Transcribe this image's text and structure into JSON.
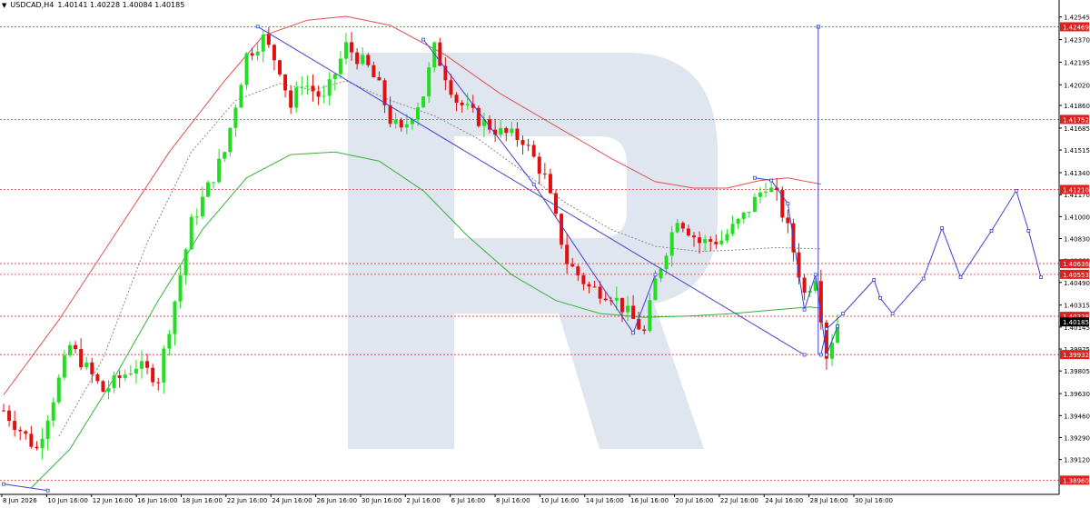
{
  "header": {
    "symbol": "USDCAD,H4",
    "ohlc": "1.40141 1.40228 1.40084 1.40185"
  },
  "chart_data": {
    "type": "candlestick",
    "symbol": "USDCAD",
    "timeframe": "H4",
    "ylim": [
      1.3885,
      1.4262
    ],
    "price_ticks": [
      "1.42545",
      "1.42370",
      "1.42195",
      "1.42020",
      "1.41860",
      "1.41685",
      "1.41515",
      "1.41340",
      "1.41170",
      "1.41000",
      "1.40830",
      "1.40660",
      "1.40490",
      "1.40315",
      "1.40145",
      "1.39975",
      "1.39805",
      "1.39630",
      "1.39460",
      "1.39290",
      "1.39120"
    ],
    "time_ticks": [
      "8 Jun 2026",
      "10 Jun 16:00",
      "12 Jun 16:00",
      "16 Jun 16:00",
      "18 Jun 16:00",
      "22 Jun 16:00",
      "24 Jun 16:00",
      "26 Jun 16:00",
      "30 Jun 16:00",
      "2 Jul 16:00",
      "6 Jul 16:00",
      "8 Jul 16:00",
      "10 Jul 16:00",
      "14 Jul 16:00",
      "16 Jul 16:00",
      "20 Jul 16:00",
      "22 Jul 16:00",
      "24 Jul 16:00",
      "28 Jul 16:00",
      "30 Jul 16:00"
    ],
    "levels": [
      {
        "label": "1.42469",
        "value": 1.42469
      },
      {
        "label": "1.41752",
        "value": 1.41752
      },
      {
        "label": "1.41210",
        "value": 1.4121
      },
      {
        "label": "1.40636",
        "value": 1.40636
      },
      {
        "label": "1.40553",
        "value": 1.40553
      },
      {
        "label": "1.40228",
        "value": 1.40228
      },
      {
        "label": "1.39932",
        "value": 1.39932
      },
      {
        "label": "1.38960",
        "value": 1.3896
      }
    ],
    "current_price": {
      "label": "1.40185",
      "value": 1.40185
    },
    "candle_count": 152,
    "price_path": [
      [
        0,
        1.395
      ],
      [
        6,
        1.392
      ],
      [
        12,
        1.4
      ],
      [
        18,
        1.3965
      ],
      [
        24,
        1.3985
      ],
      [
        28,
        1.3975
      ],
      [
        34,
        1.4095
      ],
      [
        40,
        1.415
      ],
      [
        44,
        1.4225
      ],
      [
        47,
        1.4238
      ],
      [
        50,
        1.4215
      ],
      [
        52,
        1.4185
      ],
      [
        54,
        1.4205
      ],
      [
        58,
        1.419
      ],
      [
        62,
        1.4232
      ],
      [
        66,
        1.4215
      ],
      [
        68,
        1.42
      ],
      [
        70,
        1.4175
      ],
      [
        72,
        1.4165
      ],
      [
        76,
        1.4195
      ],
      [
        78,
        1.423
      ],
      [
        82,
        1.419
      ],
      [
        86,
        1.4175
      ],
      [
        90,
        1.4165
      ],
      [
        94,
        1.416
      ],
      [
        98,
        1.413
      ],
      [
        102,
        1.4065
      ],
      [
        106,
        1.4045
      ],
      [
        110,
        1.404
      ],
      [
        114,
        1.402
      ],
      [
        116,
        1.401
      ],
      [
        118,
        1.405
      ],
      [
        122,
        1.41
      ],
      [
        126,
        1.408
      ],
      [
        130,
        1.4082
      ],
      [
        134,
        1.41
      ],
      [
        138,
        1.4125
      ],
      [
        140,
        1.4115
      ],
      [
        142,
        1.409
      ],
      [
        145,
        1.404
      ],
      [
        147,
        1.4055
      ],
      [
        149,
        1.3993
      ],
      [
        151,
        1.4018
      ]
    ],
    "moving_averages": [
      {
        "name": "",
        "color": "#e05050",
        "points": [
          [
            0,
            1.3962
          ],
          [
            10,
            1.402
          ],
          [
            20,
            1.4085
          ],
          [
            30,
            1.415
          ],
          [
            40,
            1.4205
          ],
          [
            47,
            1.424
          ],
          [
            55,
            1.4252
          ],
          [
            62,
            1.4255
          ],
          [
            70,
            1.4248
          ],
          [
            80,
            1.4225
          ],
          [
            90,
            1.4195
          ],
          [
            100,
            1.417
          ],
          [
            110,
            1.4145
          ],
          [
            118,
            1.4127
          ],
          [
            125,
            1.4122
          ],
          [
            131,
            1.4122
          ],
          [
            137,
            1.4128
          ],
          [
            142,
            1.413
          ],
          [
            148,
            1.4125
          ]
        ]
      },
      {
        "name": "",
        "color": "#39b039",
        "points": [
          [
            5,
            1.389
          ],
          [
            12,
            1.392
          ],
          [
            20,
            1.3975
          ],
          [
            28,
            1.4035
          ],
          [
            36,
            1.409
          ],
          [
            44,
            1.413
          ],
          [
            52,
            1.4148
          ],
          [
            60,
            1.415
          ],
          [
            68,
            1.4143
          ],
          [
            76,
            1.412
          ],
          [
            84,
            1.4085
          ],
          [
            92,
            1.4055
          ],
          [
            100,
            1.4035
          ],
          [
            108,
            1.4025
          ],
          [
            116,
            1.4022
          ],
          [
            124,
            1.4023
          ],
          [
            132,
            1.4025
          ],
          [
            140,
            1.4028
          ],
          [
            146,
            1.403
          ],
          [
            148,
            1.4029
          ]
        ]
      },
      {
        "name": "",
        "color": "#888888",
        "dashed": true,
        "points": [
          [
            10,
            1.393
          ],
          [
            18,
            1.399
          ],
          [
            26,
            1.408
          ],
          [
            34,
            1.415
          ],
          [
            42,
            1.419
          ],
          [
            50,
            1.4203
          ],
          [
            56,
            1.4198
          ],
          [
            62,
            1.4205
          ],
          [
            70,
            1.419
          ],
          [
            78,
            1.4178
          ],
          [
            86,
            1.416
          ],
          [
            94,
            1.4135
          ],
          [
            102,
            1.411
          ],
          [
            110,
            1.409
          ],
          [
            118,
            1.4077
          ],
          [
            126,
            1.4073
          ],
          [
            132,
            1.4074
          ],
          [
            140,
            1.4076
          ],
          [
            148,
            1.4075
          ]
        ]
      }
    ],
    "trend_lines": [
      {
        "color": "#4040d0",
        "points": [
          [
            46,
            1.4247
          ],
          [
            145,
            1.3993
          ]
        ]
      },
      {
        "color": "#4040d0",
        "points": [
          [
            76,
            1.4237
          ],
          [
            96,
            1.4125
          ],
          [
            114,
            1.401
          ],
          [
            118,
            1.4055
          ]
        ]
      },
      {
        "color": "#4040d0",
        "points": [
          [
            136,
            1.413
          ],
          [
            139,
            1.4128
          ],
          [
            142,
            1.411
          ],
          [
            145,
            1.4028
          ],
          [
            147,
            1.4055
          ],
          [
            149,
            1.3993
          ],
          [
            151,
            1.4015
          ]
        ]
      },
      {
        "color": "#4040d0",
        "points": [
          [
            0,
            1.3893
          ],
          [
            8,
            1.3888
          ]
        ]
      }
    ],
    "vertical_line": {
      "color": "#4040d0",
      "x": 147.5,
      "y_top": 1.42469,
      "y_bottom": 1.39932
    },
    "forecast": {
      "color": "#4040d0",
      "points": [
        [
          148,
          1.3993
        ],
        [
          149,
          1.4013
        ],
        [
          152,
          1.4025
        ],
        [
          157,
          1.4051
        ],
        [
          158,
          1.4037
        ],
        [
          160,
          1.4025
        ],
        [
          165,
          1.4052
        ],
        [
          168,
          1.4091
        ],
        [
          171,
          1.4053
        ],
        [
          176,
          1.4089
        ],
        [
          180,
          1.412
        ],
        [
          182,
          1.4089
        ],
        [
          184,
          1.4053
        ]
      ]
    }
  }
}
